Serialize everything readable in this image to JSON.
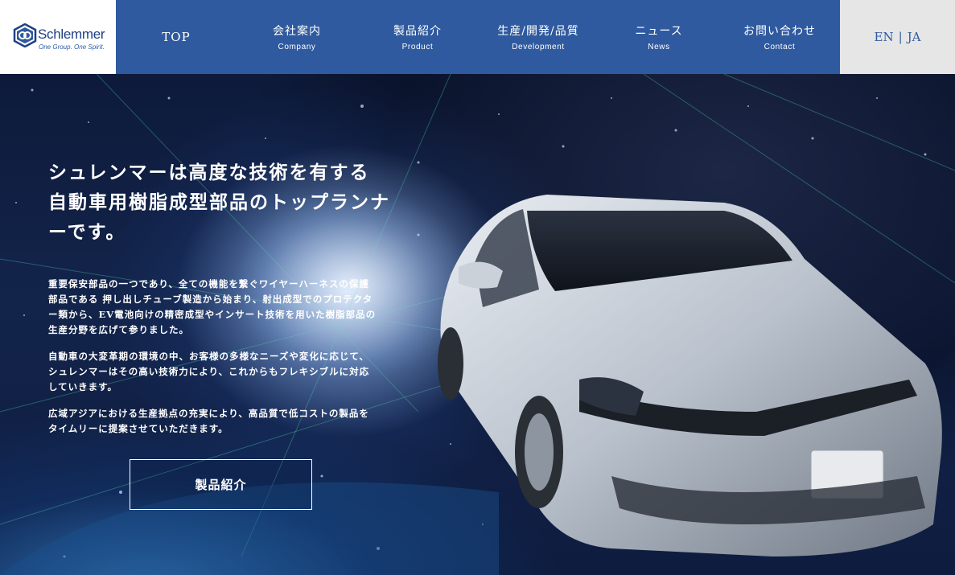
{
  "brand": {
    "name": "Schlemmer",
    "tagline": "One Group. One Spirit."
  },
  "nav": {
    "items": [
      {
        "ja": "TOP",
        "en": ""
      },
      {
        "ja": "会社案内",
        "en": "Company"
      },
      {
        "ja": "製品紹介",
        "en": "Product"
      },
      {
        "ja": "生産/開発/品質",
        "en": "Development"
      },
      {
        "ja": "ニュース",
        "en": "News"
      },
      {
        "ja": "お問い合わせ",
        "en": "Contact"
      }
    ],
    "lang_en": "EN",
    "lang_sep": "|",
    "lang_ja": "JA"
  },
  "hero": {
    "title_lines": [
      "シュレンマーは高度な技術を有する",
      "自動車用樹脂成型部品のトップランナ",
      "ーです。"
    ],
    "paragraphs": [
      [
        "重要保安部品の一つであり、全ての機能を繋ぐワイヤーハーネスの保護",
        "部品である 押し出しチューブ製造から始まり、射出成型でのプロテクタ",
        "ー類から、EV電池向けの精密成型やインサート技術を用いた樹脂部品の",
        "生産分野を広げて参りました。"
      ],
      [
        "自動車の大変革期の環境の中、お客様の多様なニーズや変化に応じて、",
        "シュレンマーはその高い技術力により、これからもフレキシブルに対応",
        "していきます。"
      ],
      [
        "広域アジアにおける生産拠点の充実により、高品質で低コストの製品を",
        "タイムリーに提案させていただきます。"
      ]
    ],
    "cta_label": "製品紹介"
  },
  "colors": {
    "nav_bg": "#2f5a9f",
    "lang_bg": "#e6e6e6",
    "brand_blue": "#1f3f87"
  }
}
